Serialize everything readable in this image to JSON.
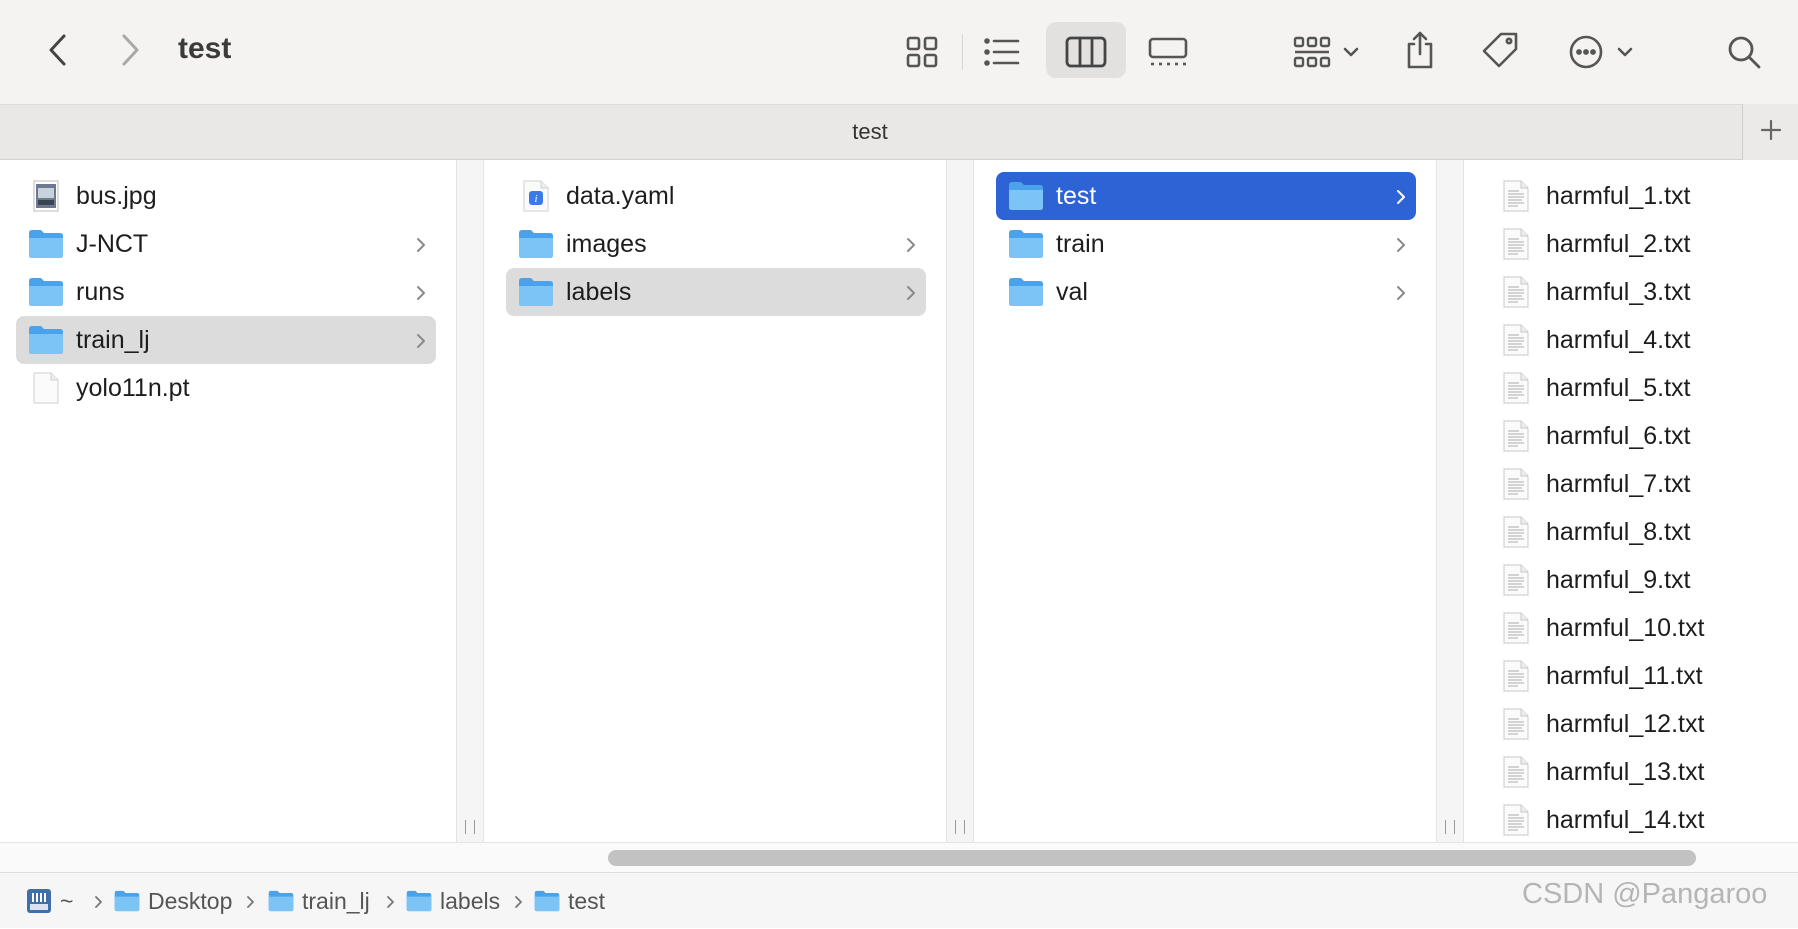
{
  "window": {
    "title": "test",
    "tab_title": "test"
  },
  "toolbar": {
    "back_icon": "chevron-left-icon",
    "forward_icon": "chevron-right-icon",
    "view_modes": [
      "icon-view",
      "list-view",
      "column-view",
      "gallery-view"
    ],
    "active_view": "column-view"
  },
  "columns": [
    {
      "items": [
        {
          "label": "bus.jpg",
          "type": "image",
          "has_children": false,
          "selected": ""
        },
        {
          "label": "J-NCT",
          "type": "folder",
          "has_children": true,
          "selected": ""
        },
        {
          "label": "runs",
          "type": "folder",
          "has_children": true,
          "selected": ""
        },
        {
          "label": "train_lj",
          "type": "folder",
          "has_children": true,
          "selected": "inactive"
        },
        {
          "label": "yolo11n.pt",
          "type": "file",
          "has_children": false,
          "selected": ""
        }
      ]
    },
    {
      "items": [
        {
          "label": "data.yaml",
          "type": "yaml",
          "has_children": false,
          "selected": ""
        },
        {
          "label": "images",
          "type": "folder",
          "has_children": true,
          "selected": ""
        },
        {
          "label": "labels",
          "type": "folder",
          "has_children": true,
          "selected": "inactive"
        }
      ]
    },
    {
      "items": [
        {
          "label": "test",
          "type": "folder",
          "has_children": true,
          "selected": "active"
        },
        {
          "label": "train",
          "type": "folder",
          "has_children": true,
          "selected": ""
        },
        {
          "label": "val",
          "type": "folder",
          "has_children": true,
          "selected": ""
        }
      ]
    },
    {
      "items": [
        {
          "label": "harmful_1.txt",
          "type": "text",
          "has_children": false,
          "selected": ""
        },
        {
          "label": "harmful_2.txt",
          "type": "text",
          "has_children": false,
          "selected": ""
        },
        {
          "label": "harmful_3.txt",
          "type": "text",
          "has_children": false,
          "selected": ""
        },
        {
          "label": "harmful_4.txt",
          "type": "text",
          "has_children": false,
          "selected": ""
        },
        {
          "label": "harmful_5.txt",
          "type": "text",
          "has_children": false,
          "selected": ""
        },
        {
          "label": "harmful_6.txt",
          "type": "text",
          "has_children": false,
          "selected": ""
        },
        {
          "label": "harmful_7.txt",
          "type": "text",
          "has_children": false,
          "selected": ""
        },
        {
          "label": "harmful_8.txt",
          "type": "text",
          "has_children": false,
          "selected": ""
        },
        {
          "label": "harmful_9.txt",
          "type": "text",
          "has_children": false,
          "selected": ""
        },
        {
          "label": "harmful_10.txt",
          "type": "text",
          "has_children": false,
          "selected": ""
        },
        {
          "label": "harmful_11.txt",
          "type": "text",
          "has_children": false,
          "selected": ""
        },
        {
          "label": "harmful_12.txt",
          "type": "text",
          "has_children": false,
          "selected": ""
        },
        {
          "label": "harmful_13.txt",
          "type": "text",
          "has_children": false,
          "selected": ""
        },
        {
          "label": "harmful_14.txt",
          "type": "text",
          "has_children": false,
          "selected": ""
        }
      ]
    }
  ],
  "pathbar": {
    "items": [
      {
        "label": "~",
        "icon": "disk-icon"
      },
      {
        "label": "Desktop",
        "icon": "folder-icon"
      },
      {
        "label": "train_lj",
        "icon": "folder-icon"
      },
      {
        "label": "labels",
        "icon": "folder-icon"
      },
      {
        "label": "test",
        "icon": "folder-icon"
      }
    ]
  },
  "watermark": "CSDN @Pangaroo",
  "colors": {
    "selection_active": "#2e63d6",
    "selection_inactive": "#dcdcdc",
    "folder": "#5fb3f0"
  }
}
